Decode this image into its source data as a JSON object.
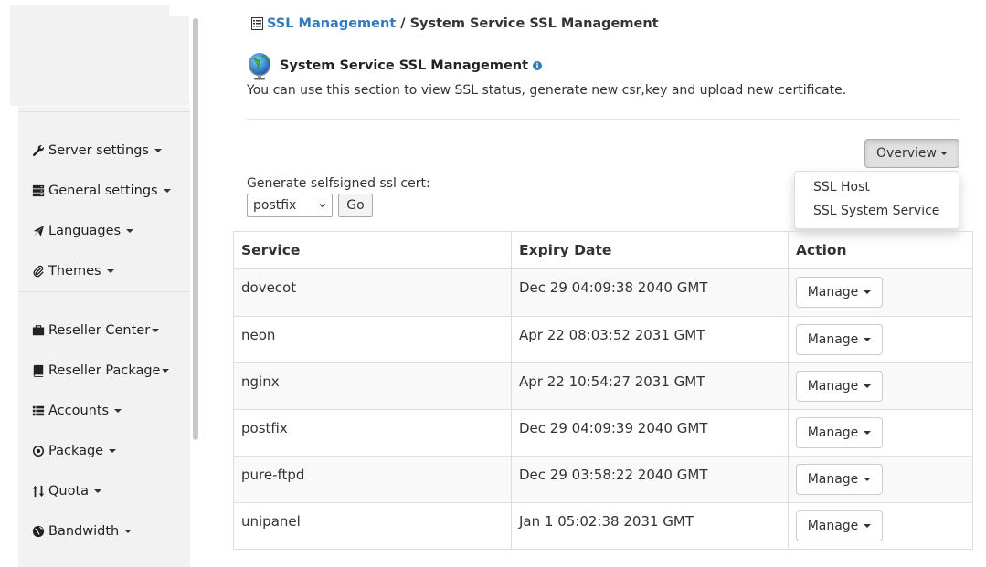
{
  "breadcrumb": {
    "link": "SSL Management",
    "separator": "/",
    "current": "System Service SSL Management"
  },
  "page": {
    "title": "System Service SSL Management",
    "info_glyph": "i",
    "description": "You can use this section to view SSL status, generate new csr,key and upload new certificate."
  },
  "sidebar": {
    "items": [
      {
        "label": "Server settings",
        "icon": "wrench-icon"
      },
      {
        "label": "General settings",
        "icon": "server-icon"
      },
      {
        "label": "Languages",
        "icon": "paper-plane-icon"
      },
      {
        "label": "Themes",
        "icon": "paperclip-icon"
      },
      {
        "label": "Reseller Center",
        "icon": "briefcase-icon"
      },
      {
        "label": "Reseller Package",
        "icon": "book-icon"
      },
      {
        "label": "Accounts",
        "icon": "list-icon"
      },
      {
        "label": "Package",
        "icon": "circle-dot-icon"
      },
      {
        "label": "Quota",
        "icon": "sort-arrows-icon"
      },
      {
        "label": "Bandwidth",
        "icon": "globe-icon"
      }
    ]
  },
  "overview": {
    "button_label": "Overview",
    "menu": [
      "SSL Host",
      "SSL System Service"
    ]
  },
  "generate": {
    "label": "Generate selfsigned ssl cert:",
    "selected": "postfix",
    "go_label": "Go"
  },
  "table": {
    "headers": [
      "Service",
      "Expiry Date",
      "Action"
    ],
    "rows": [
      {
        "service": "dovecot",
        "expiry": "Dec 29 04:09:38 2040 GMT",
        "action": "Manage"
      },
      {
        "service": "neon",
        "expiry": "Apr 22 08:03:52 2031 GMT",
        "action": "Manage"
      },
      {
        "service": "nginx",
        "expiry": "Apr 22 10:54:27 2031 GMT",
        "action": "Manage"
      },
      {
        "service": "postfix",
        "expiry": "Dec 29 04:09:39 2040 GMT",
        "action": "Manage"
      },
      {
        "service": "pure-ftpd",
        "expiry": "Dec 29 03:58:22 2040 GMT",
        "action": "Manage"
      },
      {
        "service": "unipanel",
        "expiry": "Jan 1 05:02:38 2031 GMT",
        "action": "Manage"
      }
    ]
  },
  "colors": {
    "link": "#337ab7",
    "sidebar_bg": "#f2f2f2",
    "stripe": "#f9f9f9",
    "border": "#dddddd"
  }
}
